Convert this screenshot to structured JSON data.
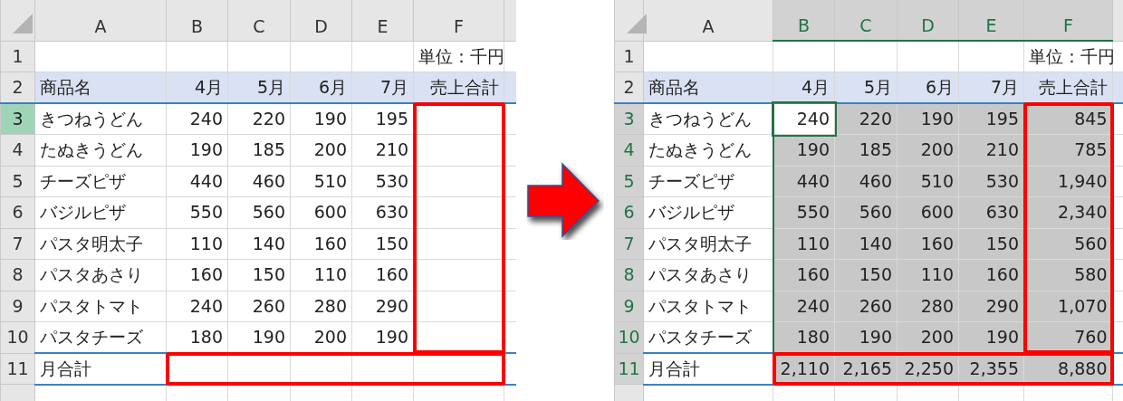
{
  "sheets": [
    {
      "columns": [
        {
          "label": "A",
          "selected": false,
          "boxed": false
        },
        {
          "label": "B",
          "selected": false,
          "boxed": false
        },
        {
          "label": "C",
          "selected": false,
          "boxed": false
        },
        {
          "label": "D",
          "selected": false,
          "boxed": false
        },
        {
          "label": "E",
          "selected": false,
          "boxed": false
        },
        {
          "label": "F",
          "selected": false,
          "boxed": true
        }
      ],
      "rows": [
        {
          "label": "1",
          "selected": false,
          "boxed": false,
          "kind": "note",
          "cells": [
            {
              "text": "",
              "selected": false,
              "active": false
            },
            {
              "text": "",
              "selected": false,
              "active": false
            },
            {
              "text": "",
              "selected": false,
              "active": false
            },
            {
              "text": "",
              "selected": false,
              "active": false
            },
            {
              "text": "",
              "selected": false,
              "active": false
            },
            {
              "text": "単位：千円",
              "selected": false,
              "active": false
            }
          ]
        },
        {
          "label": "2",
          "selected": false,
          "boxed": false,
          "kind": "header",
          "cells": [
            {
              "text": "商品名",
              "selected": false,
              "active": false
            },
            {
              "text": "4月",
              "selected": false,
              "active": false
            },
            {
              "text": "5月",
              "selected": false,
              "active": false
            },
            {
              "text": "6月",
              "selected": false,
              "active": false
            },
            {
              "text": "7月",
              "selected": false,
              "active": false
            },
            {
              "text": "売上合計",
              "selected": false,
              "active": false
            }
          ]
        },
        {
          "label": "3",
          "selected": true,
          "boxed": false,
          "kind": "item",
          "cells": [
            {
              "text": "きつねうどん",
              "selected": false,
              "active": false
            },
            {
              "text": "240",
              "selected": false,
              "active": false
            },
            {
              "text": "220",
              "selected": false,
              "active": false
            },
            {
              "text": "190",
              "selected": false,
              "active": false
            },
            {
              "text": "195",
              "selected": false,
              "active": false
            },
            {
              "text": "",
              "selected": false,
              "active": false
            }
          ]
        },
        {
          "label": "4",
          "selected": false,
          "boxed": false,
          "kind": "item",
          "cells": [
            {
              "text": "たぬきうどん",
              "selected": false,
              "active": false
            },
            {
              "text": "190",
              "selected": false,
              "active": false
            },
            {
              "text": "185",
              "selected": false,
              "active": false
            },
            {
              "text": "200",
              "selected": false,
              "active": false
            },
            {
              "text": "210",
              "selected": false,
              "active": false
            },
            {
              "text": "",
              "selected": false,
              "active": false
            }
          ]
        },
        {
          "label": "5",
          "selected": false,
          "boxed": false,
          "kind": "item",
          "cells": [
            {
              "text": "チーズピザ",
              "selected": false,
              "active": false
            },
            {
              "text": "440",
              "selected": false,
              "active": false
            },
            {
              "text": "460",
              "selected": false,
              "active": false
            },
            {
              "text": "510",
              "selected": false,
              "active": false
            },
            {
              "text": "530",
              "selected": false,
              "active": false
            },
            {
              "text": "",
              "selected": false,
              "active": false
            }
          ]
        },
        {
          "label": "6",
          "selected": false,
          "boxed": false,
          "kind": "item",
          "cells": [
            {
              "text": "バジルピザ",
              "selected": false,
              "active": false
            },
            {
              "text": "550",
              "selected": false,
              "active": false
            },
            {
              "text": "560",
              "selected": false,
              "active": false
            },
            {
              "text": "600",
              "selected": false,
              "active": false
            },
            {
              "text": "630",
              "selected": false,
              "active": false
            },
            {
              "text": "",
              "selected": false,
              "active": false
            }
          ]
        },
        {
          "label": "7",
          "selected": false,
          "boxed": false,
          "kind": "item",
          "cells": [
            {
              "text": "パスタ明太子",
              "selected": false,
              "active": false
            },
            {
              "text": "110",
              "selected": false,
              "active": false
            },
            {
              "text": "140",
              "selected": false,
              "active": false
            },
            {
              "text": "160",
              "selected": false,
              "active": false
            },
            {
              "text": "150",
              "selected": false,
              "active": false
            },
            {
              "text": "",
              "selected": false,
              "active": false
            }
          ]
        },
        {
          "label": "8",
          "selected": false,
          "boxed": false,
          "kind": "item",
          "cells": [
            {
              "text": "パスタあさり",
              "selected": false,
              "active": false
            },
            {
              "text": "160",
              "selected": false,
              "active": false
            },
            {
              "text": "150",
              "selected": false,
              "active": false
            },
            {
              "text": "110",
              "selected": false,
              "active": false
            },
            {
              "text": "160",
              "selected": false,
              "active": false
            },
            {
              "text": "",
              "selected": false,
              "active": false
            }
          ]
        },
        {
          "label": "9",
          "selected": false,
          "boxed": false,
          "kind": "item",
          "cells": [
            {
              "text": "パスタトマト",
              "selected": false,
              "active": false
            },
            {
              "text": "240",
              "selected": false,
              "active": false
            },
            {
              "text": "260",
              "selected": false,
              "active": false
            },
            {
              "text": "280",
              "selected": false,
              "active": false
            },
            {
              "text": "290",
              "selected": false,
              "active": false
            },
            {
              "text": "",
              "selected": false,
              "active": false
            }
          ]
        },
        {
          "label": "10",
          "selected": false,
          "boxed": false,
          "kind": "item",
          "cells": [
            {
              "text": "パスタチーズ",
              "selected": false,
              "active": false
            },
            {
              "text": "180",
              "selected": false,
              "active": false
            },
            {
              "text": "190",
              "selected": false,
              "active": false
            },
            {
              "text": "200",
              "selected": false,
              "active": false
            },
            {
              "text": "190",
              "selected": false,
              "active": false
            },
            {
              "text": "",
              "selected": false,
              "active": false
            }
          ]
        },
        {
          "label": "11",
          "selected": false,
          "boxed": true,
          "kind": "sum",
          "cells": [
            {
              "text": "月合計",
              "selected": false,
              "active": false
            },
            {
              "text": "",
              "selected": false,
              "active": false
            },
            {
              "text": "",
              "selected": false,
              "active": false
            },
            {
              "text": "",
              "selected": false,
              "active": false
            },
            {
              "text": "",
              "selected": false,
              "active": false
            },
            {
              "text": "",
              "selected": false,
              "active": false
            }
          ]
        }
      ]
    },
    {
      "columns": [
        {
          "label": "A",
          "selected": false,
          "boxed": false
        },
        {
          "label": "B",
          "selected": true,
          "boxed": false
        },
        {
          "label": "C",
          "selected": true,
          "boxed": false
        },
        {
          "label": "D",
          "selected": true,
          "boxed": false
        },
        {
          "label": "E",
          "selected": true,
          "boxed": false
        },
        {
          "label": "F",
          "selected": true,
          "boxed": true
        }
      ],
      "rows": [
        {
          "label": "1",
          "selected": false,
          "boxed": false,
          "kind": "note",
          "cells": [
            {
              "text": "",
              "selected": false,
              "active": false
            },
            {
              "text": "",
              "selected": false,
              "active": false
            },
            {
              "text": "",
              "selected": false,
              "active": false
            },
            {
              "text": "",
              "selected": false,
              "active": false
            },
            {
              "text": "",
              "selected": false,
              "active": false
            },
            {
              "text": "単位：千円",
              "selected": false,
              "active": false
            }
          ]
        },
        {
          "label": "2",
          "selected": false,
          "boxed": false,
          "kind": "header",
          "cells": [
            {
              "text": "商品名",
              "selected": false,
              "active": false
            },
            {
              "text": "4月",
              "selected": false,
              "active": false
            },
            {
              "text": "5月",
              "selected": false,
              "active": false
            },
            {
              "text": "6月",
              "selected": false,
              "active": false
            },
            {
              "text": "7月",
              "selected": false,
              "active": false
            },
            {
              "text": "売上合計",
              "selected": false,
              "active": false
            }
          ]
        },
        {
          "label": "3",
          "selected": true,
          "boxed": false,
          "kind": "item",
          "cells": [
            {
              "text": "きつねうどん",
              "selected": false,
              "active": false
            },
            {
              "text": "240",
              "selected": true,
              "active": true
            },
            {
              "text": "220",
              "selected": true,
              "active": false
            },
            {
              "text": "190",
              "selected": true,
              "active": false
            },
            {
              "text": "195",
              "selected": true,
              "active": false
            },
            {
              "text": "845",
              "selected": true,
              "active": false
            }
          ]
        },
        {
          "label": "4",
          "selected": true,
          "boxed": false,
          "kind": "item",
          "cells": [
            {
              "text": "たぬきうどん",
              "selected": false,
              "active": false
            },
            {
              "text": "190",
              "selected": true,
              "active": false
            },
            {
              "text": "185",
              "selected": true,
              "active": false
            },
            {
              "text": "200",
              "selected": true,
              "active": false
            },
            {
              "text": "210",
              "selected": true,
              "active": false
            },
            {
              "text": "785",
              "selected": true,
              "active": false
            }
          ]
        },
        {
          "label": "5",
          "selected": true,
          "boxed": false,
          "kind": "item",
          "cells": [
            {
              "text": "チーズピザ",
              "selected": false,
              "active": false
            },
            {
              "text": "440",
              "selected": true,
              "active": false
            },
            {
              "text": "460",
              "selected": true,
              "active": false
            },
            {
              "text": "510",
              "selected": true,
              "active": false
            },
            {
              "text": "530",
              "selected": true,
              "active": false
            },
            {
              "text": "1,940",
              "selected": true,
              "active": false
            }
          ]
        },
        {
          "label": "6",
          "selected": true,
          "boxed": false,
          "kind": "item",
          "cells": [
            {
              "text": "バジルピザ",
              "selected": false,
              "active": false
            },
            {
              "text": "550",
              "selected": true,
              "active": false
            },
            {
              "text": "560",
              "selected": true,
              "active": false
            },
            {
              "text": "600",
              "selected": true,
              "active": false
            },
            {
              "text": "630",
              "selected": true,
              "active": false
            },
            {
              "text": "2,340",
              "selected": true,
              "active": false
            }
          ]
        },
        {
          "label": "7",
          "selected": true,
          "boxed": false,
          "kind": "item",
          "cells": [
            {
              "text": "パスタ明太子",
              "selected": false,
              "active": false
            },
            {
              "text": "110",
              "selected": true,
              "active": false
            },
            {
              "text": "140",
              "selected": true,
              "active": false
            },
            {
              "text": "160",
              "selected": true,
              "active": false
            },
            {
              "text": "150",
              "selected": true,
              "active": false
            },
            {
              "text": "560",
              "selected": true,
              "active": false
            }
          ]
        },
        {
          "label": "8",
          "selected": true,
          "boxed": false,
          "kind": "item",
          "cells": [
            {
              "text": "パスタあさり",
              "selected": false,
              "active": false
            },
            {
              "text": "160",
              "selected": true,
              "active": false
            },
            {
              "text": "150",
              "selected": true,
              "active": false
            },
            {
              "text": "110",
              "selected": true,
              "active": false
            },
            {
              "text": "160",
              "selected": true,
              "active": false
            },
            {
              "text": "580",
              "selected": true,
              "active": false
            }
          ]
        },
        {
          "label": "9",
          "selected": true,
          "boxed": false,
          "kind": "item",
          "cells": [
            {
              "text": "パスタトマト",
              "selected": false,
              "active": false
            },
            {
              "text": "240",
              "selected": true,
              "active": false
            },
            {
              "text": "260",
              "selected": true,
              "active": false
            },
            {
              "text": "280",
              "selected": true,
              "active": false
            },
            {
              "text": "290",
              "selected": true,
              "active": false
            },
            {
              "text": "1,070",
              "selected": true,
              "active": false
            }
          ]
        },
        {
          "label": "10",
          "selected": true,
          "boxed": false,
          "kind": "item",
          "cells": [
            {
              "text": "パスタチーズ",
              "selected": false,
              "active": false
            },
            {
              "text": "180",
              "selected": true,
              "active": false
            },
            {
              "text": "190",
              "selected": true,
              "active": false
            },
            {
              "text": "200",
              "selected": true,
              "active": false
            },
            {
              "text": "190",
              "selected": true,
              "active": false
            },
            {
              "text": "760",
              "selected": true,
              "active": false
            }
          ]
        },
        {
          "label": "11",
          "selected": true,
          "boxed": true,
          "kind": "sum",
          "cells": [
            {
              "text": "月合計",
              "selected": false,
              "active": false
            },
            {
              "text": "2,110",
              "selected": true,
              "active": false
            },
            {
              "text": "2,165",
              "selected": true,
              "active": false
            },
            {
              "text": "2,250",
              "selected": true,
              "active": false
            },
            {
              "text": "2,355",
              "selected": true,
              "active": false
            },
            {
              "text": "8,880",
              "selected": true,
              "active": false
            }
          ]
        }
      ]
    }
  ]
}
